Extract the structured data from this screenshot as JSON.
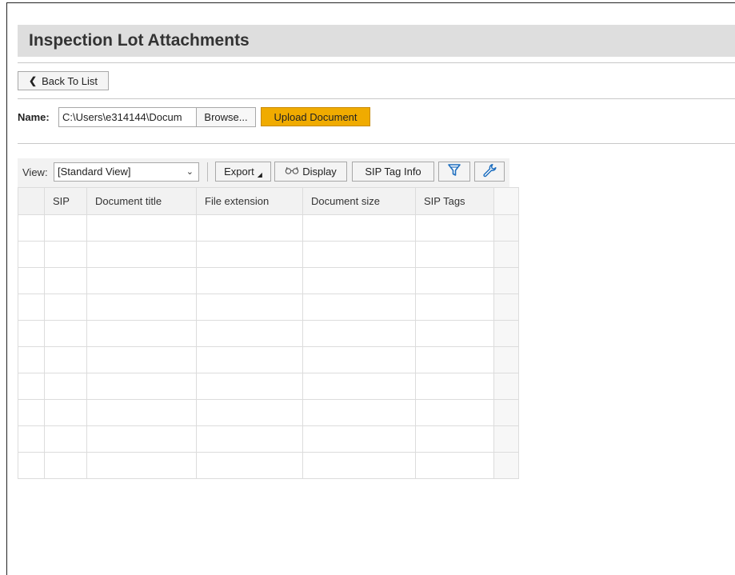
{
  "header": {
    "title": "Inspection Lot Attachments"
  },
  "nav": {
    "back_label": "Back To List"
  },
  "upload": {
    "name_label": "Name:",
    "path_value": "C:\\Users\\e314144\\Docum",
    "browse_label": "Browse...",
    "upload_label": "Upload Document"
  },
  "toolbar": {
    "view_label": "View:",
    "view_selected": "[Standard View]",
    "export_label": "Export",
    "display_label": "Display",
    "sip_tag_info_label": "SIP Tag Info"
  },
  "table": {
    "columns": [
      "SIP",
      "Document title",
      "File extension",
      "Document size",
      "SIP Tags"
    ],
    "empty_rows": 10
  },
  "colors": {
    "accent_upload": "#f0ab00",
    "icon_blue": "#1f6fbf",
    "title_bar": "#dedede"
  }
}
